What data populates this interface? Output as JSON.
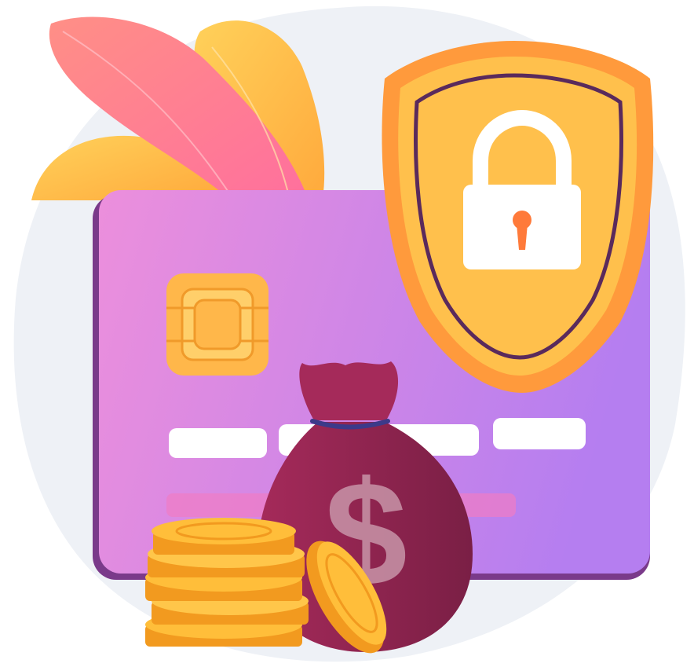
{
  "illustration": {
    "dollar_symbol": "$"
  },
  "colors": {
    "background_blob": "#eef1f6",
    "card_start": "#ec8fdc",
    "card_end": "#b57ef0",
    "card_edge": "#7a3a8a",
    "chip": "#ffb74a",
    "shield_outer": "#ff9a3c",
    "shield_inner": "#ffc04c",
    "shield_outline": "#5a2a5c",
    "lock_body": "#ffffff",
    "keyhole": "#ff7a3a",
    "bag": "#8c2350",
    "bag_tie": "#3c3a8a",
    "coin": "#ffbe3a",
    "coin_edge": "#f29a1f",
    "leaf_pink": "#ff7f9c",
    "leaf_yellow": "#ffbe4a"
  },
  "icons": [
    "credit-card",
    "security-shield",
    "padlock",
    "money-bag",
    "coin-stack",
    "leaves"
  ]
}
